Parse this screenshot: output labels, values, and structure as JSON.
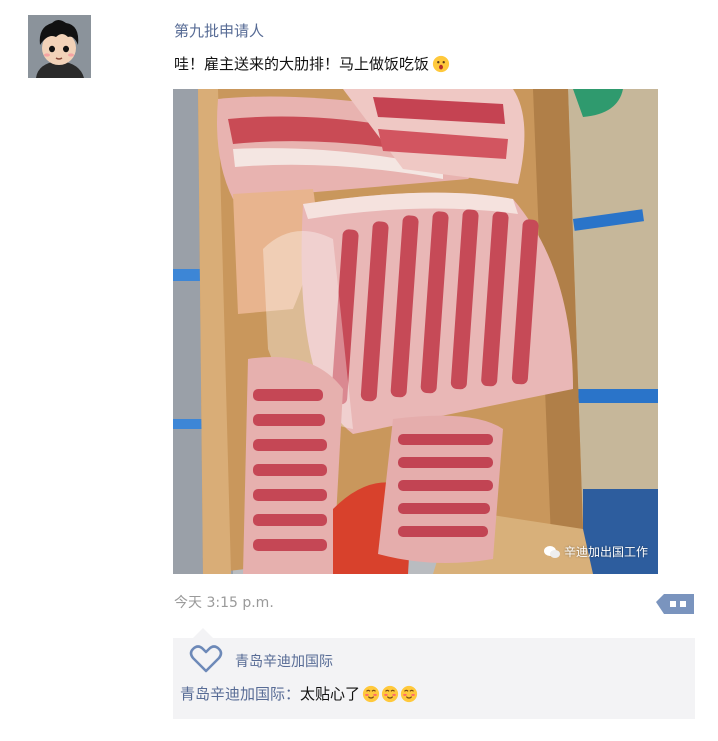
{
  "post": {
    "author": "第九批申请人",
    "text": "哇！雇主送来的大肋排！马上做饭吃饭",
    "text_emoji_icon": "surprised-face-emoji",
    "photo": {
      "description_icon": "pork-ribs-photo",
      "watermark": "辛迪加出国工作",
      "watermark_icon": "wechat-icon"
    },
    "timestamp": "今天 3:15 p.m.",
    "more_icon": "comment-more-icon"
  },
  "interactions": {
    "like_icon": "heart-outline-icon",
    "likes": [
      "青岛辛迪加国际"
    ],
    "comments": [
      {
        "author": "青岛辛迪加国际",
        "separator": "：",
        "text": "太贴心了",
        "emoji_icons": [
          "blushing-face-emoji",
          "blushing-face-emoji",
          "blushing-face-emoji"
        ]
      }
    ]
  },
  "colors": {
    "link_blue": "#576b95",
    "timestamp_gray": "#9a9a9a",
    "comment_bg": "#f3f3f5",
    "more_button": "#6d89b8"
  }
}
